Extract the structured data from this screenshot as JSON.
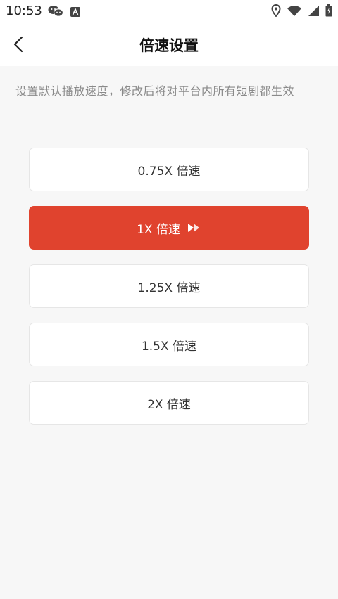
{
  "status_bar": {
    "time": "10:53",
    "left_icons": [
      "wechat-icon",
      "text-a-icon"
    ],
    "right_icons": [
      "location-icon",
      "wifi-icon",
      "signal-icon",
      "battery-icon"
    ]
  },
  "header": {
    "title": "倍速设置",
    "back_icon": "chevron-left-icon"
  },
  "description": "设置默认播放速度，修改后将对平台内所有短剧都生效",
  "speed_options": [
    {
      "label": "0.75X 倍速",
      "selected": false
    },
    {
      "label": "1X 倍速",
      "selected": true
    },
    {
      "label": "1.25X 倍速",
      "selected": false
    },
    {
      "label": "1.5X 倍速",
      "selected": false
    },
    {
      "label": "2X 倍速",
      "selected": false
    }
  ],
  "colors": {
    "accent": "#e0432e",
    "background": "#f7f7f7",
    "card": "#ffffff"
  }
}
